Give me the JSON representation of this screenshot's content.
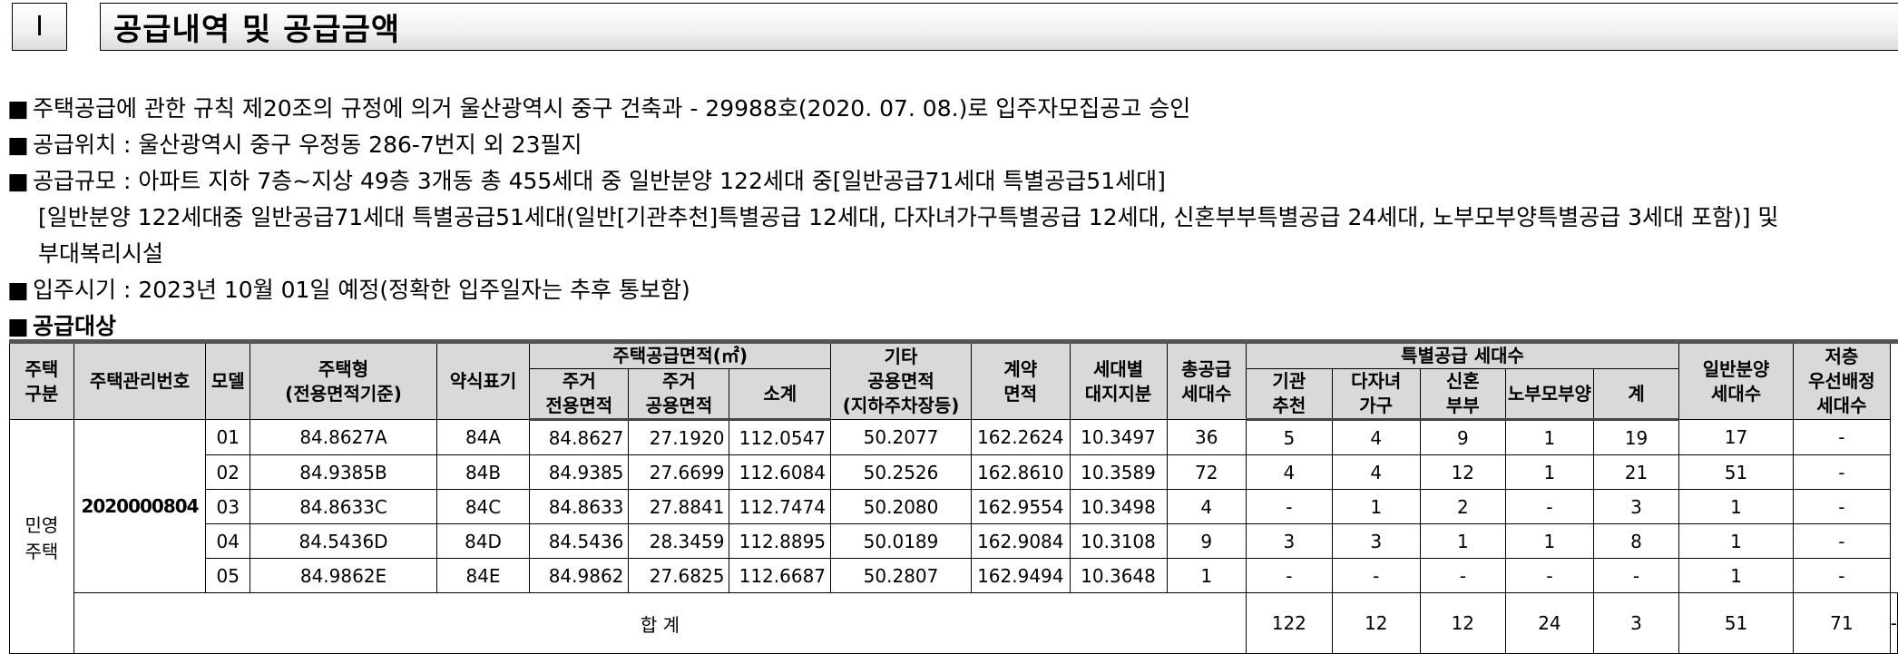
{
  "section": {
    "number": "I",
    "title": "공급내역 및 공급금액"
  },
  "bullets": [
    "주택공급에 관한 규칙 제20조의 규정에 의거 울산광역시 중구 건축과 - 29988호(2020. 07. 08.)로 입주자모집공고 승인",
    "공급위치 : 울산광역시 중구 우정동 286-7번지 외 23필지",
    "공급규모 : 아파트 지하 7층~지상 49층 3개동 총 455세대 중 일반분양 122세대 중[일반공급71세대 특별공급51세대]"
  ],
  "bullet3_cont1": "[일반분양 122세대중 일반공급71세대 특별공급51세대(일반[기관추천]특별공급 12세대, 다자녀가구특별공급 12세대, 신혼부부특별공급 24세대, 노부모부양특별공급 3세대 포함)] 및",
  "bullet3_cont2": "부대복리시설",
  "bullet4": "입주시기 : 2023년 10월 01일 예정(정확한 입주일자는 추후 통보함)",
  "section_sub": "공급대상",
  "bullet_marker": "■",
  "table": {
    "headers": {
      "housing_type": "주택\n구분",
      "mgmt_no": "주택관리번호",
      "model": "모델",
      "house_type": "주택형\n(전용면적기준)",
      "abbr": "약식표기",
      "supply_area_group": "주택공급면적(㎡)",
      "private_area": "주거\n전용면적",
      "common_area": "주거\n공용면적",
      "subtotal": "소계",
      "other_common": "기타\n공용면적\n(지하주차장등)",
      "contract_area": "계약\n면적",
      "land_share": "세대별\n대지지분",
      "total_supply": "총공급\n세대수",
      "special_group": "특별공급 세대수",
      "institution": "기관\n추천",
      "multi_child": "다자녀\n가구",
      "newlywed": "신혼\n부부",
      "parents": "노부모부양",
      "special_sum": "계",
      "general": "일반분양\n세대수",
      "low_floor": "저층\n우선배정\n세대수"
    },
    "housing_type": "민영\n주택",
    "mgmt_no": "2020000804",
    "rows": [
      [
        "01",
        "84.8627A",
        "84A",
        "84.8627",
        "27.1920",
        "112.0547",
        "50.2077",
        "162.2624",
        "10.3497",
        "36",
        "5",
        "4",
        "9",
        "1",
        "19",
        "17",
        "-"
      ],
      [
        "02",
        "84.9385B",
        "84B",
        "84.9385",
        "27.6699",
        "112.6084",
        "50.2526",
        "162.8610",
        "10.3589",
        "72",
        "4",
        "4",
        "12",
        "1",
        "21",
        "51",
        "-"
      ],
      [
        "03",
        "84.8633C",
        "84C",
        "84.8633",
        "27.8841",
        "112.7474",
        "50.2080",
        "162.9554",
        "10.3498",
        "4",
        "-",
        "1",
        "2",
        "-",
        "3",
        "1",
        "-"
      ],
      [
        "04",
        "84.5436D",
        "84D",
        "84.5436",
        "28.3459",
        "112.8895",
        "50.0189",
        "162.9084",
        "10.3108",
        "9",
        "3",
        "3",
        "1",
        "1",
        "8",
        "1",
        "-"
      ],
      [
        "05",
        "84.9862E",
        "84E",
        "84.9862",
        "27.6825",
        "112.6687",
        "50.2807",
        "162.9494",
        "10.3648",
        "1",
        "-",
        "-",
        "-",
        "-",
        "-",
        "1",
        "-"
      ]
    ],
    "total_label": "합 계",
    "totals": [
      "122",
      "12",
      "12",
      "24",
      "3",
      "51",
      "71",
      "-"
    ]
  }
}
